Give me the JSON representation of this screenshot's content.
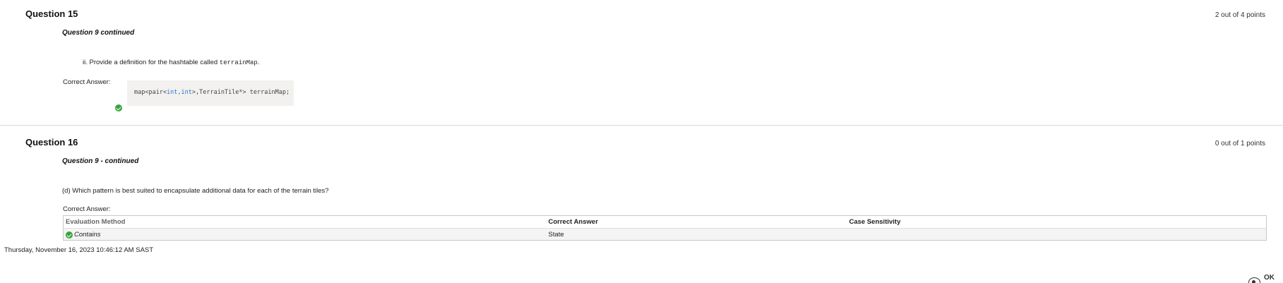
{
  "questions": [
    {
      "title": "Question 15",
      "points": "2 out of 4 points",
      "subtitle": "Question 9 continued",
      "prompt_text": "ii. Provide a definition for the hashtable called ",
      "prompt_code": "terrainMap",
      "prompt_end": ".",
      "correct_answer_label": "Correct Answer:",
      "answer_code": {
        "part1": "map<pair<",
        "part2": "int,int",
        "part3": ">,TerrainTile*> terrainMap;"
      },
      "status_icon": "check-circle-icon"
    },
    {
      "title": "Question 16",
      "points": "0 out of 1 points",
      "subtitle": "Question 9 - continued",
      "prompt_text": "(d) Which pattern is best suited to encapsulate additional data for each of the terrain tiles?",
      "correct_answer_label": "Correct Answer:",
      "table": {
        "headers": [
          "Evaluation Method",
          "Correct Answer",
          "Case Sensitivity"
        ],
        "rows": [
          {
            "evaluation_method": "Contains",
            "correct_answer": "State",
            "case_sensitivity": ""
          }
        ]
      }
    }
  ],
  "footer": {
    "timestamp": "Thursday, November 16, 2023 10:46:12 AM SAST",
    "ok_label": "OK"
  },
  "colors": {
    "check_green": "#37a63b",
    "code_keyword": "#2b74c8",
    "code_background": "#f2f1ef"
  }
}
